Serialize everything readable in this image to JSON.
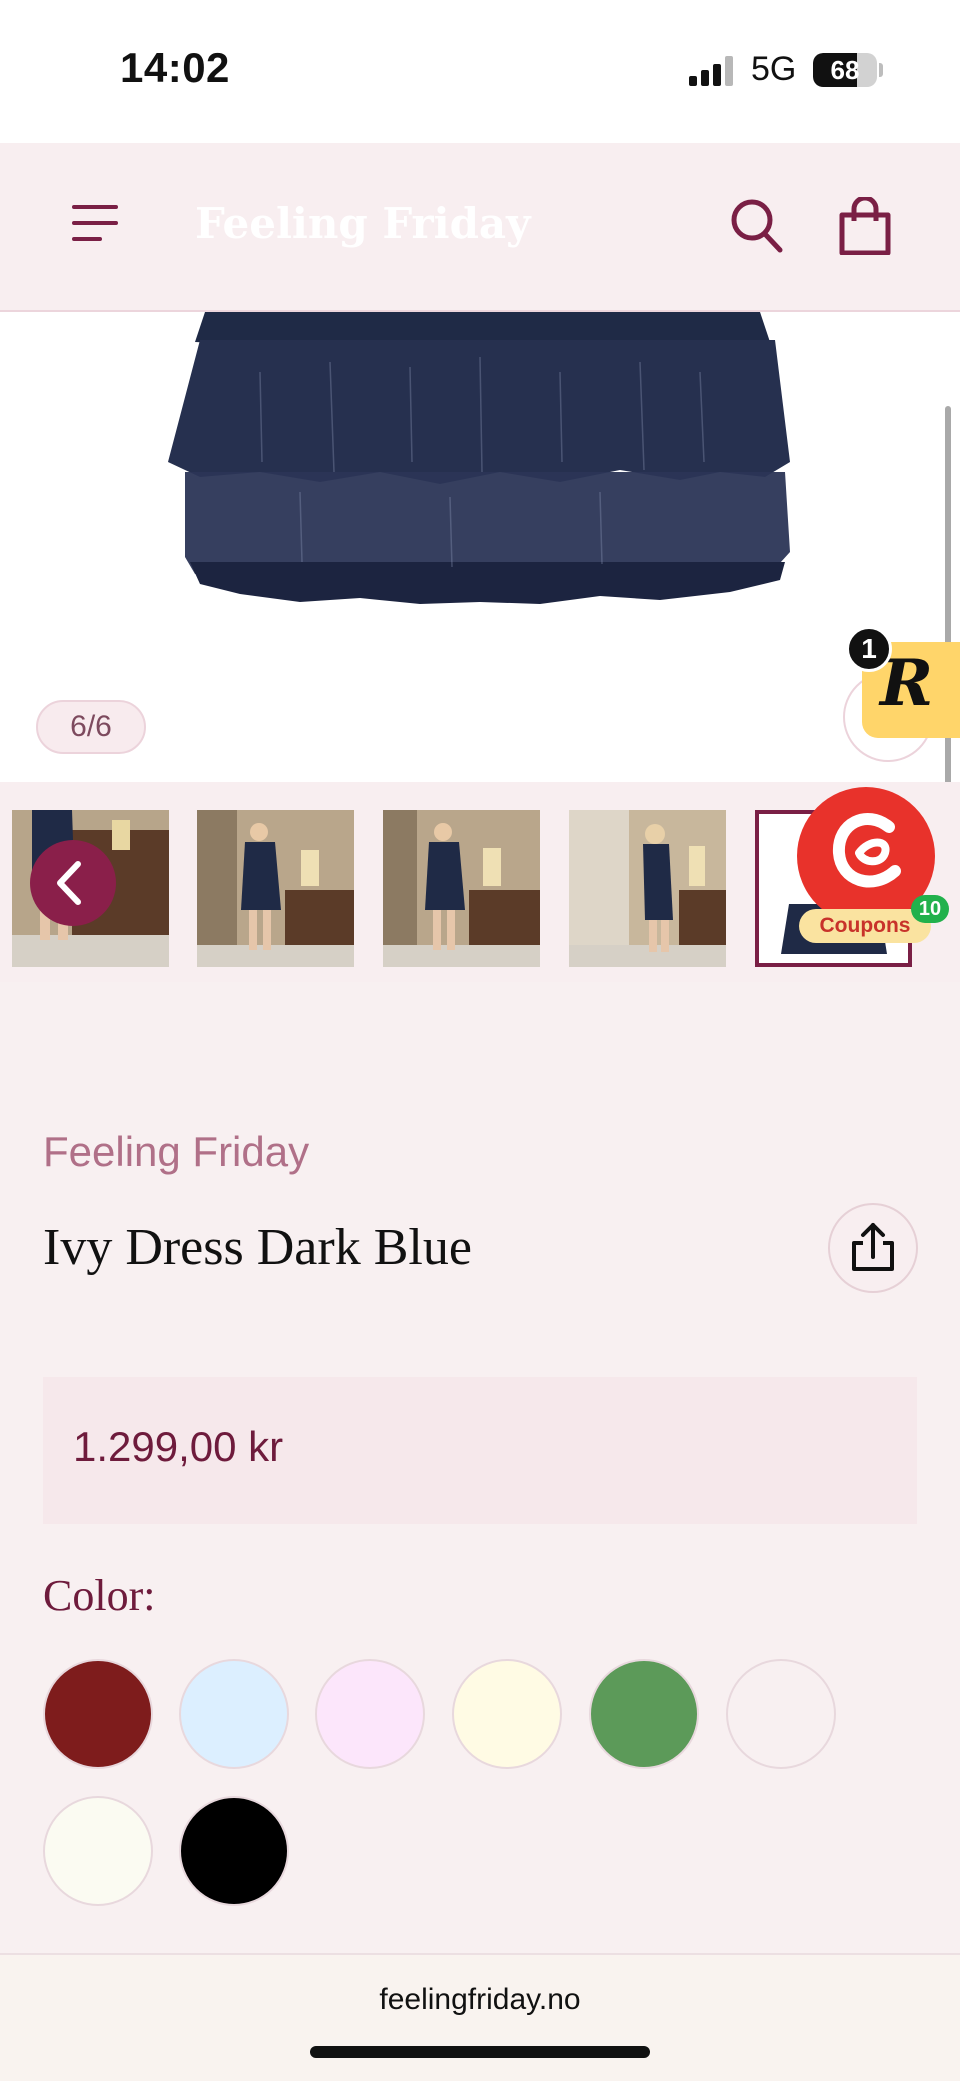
{
  "status_bar": {
    "time": "14:02",
    "network": "5G",
    "battery": "68",
    "battery_level": 0.68
  },
  "header": {
    "logo": "Feeling Friday",
    "icons": [
      "menu-icon",
      "search-icon",
      "shopping-bag-icon"
    ]
  },
  "gallery": {
    "counter": "6/6",
    "thumbnail_count": 5,
    "active_thumbnail": 5
  },
  "widgets": {
    "rewards_badge": "1",
    "rewards_logo": "R",
    "coupons_label": "Coupons",
    "coupons_count": "10"
  },
  "product": {
    "brand": "Feeling Friday",
    "title": "Ivy Dress Dark Blue",
    "price": "1.299,00 kr"
  },
  "options": {
    "color_label": "Color:",
    "swatches": [
      "#7e1c1c",
      "#dcefff",
      "#fce6fb",
      "#fffbe4",
      "#5c9a59",
      "#f8f0f1",
      "#fbfbf2",
      "#000000"
    ]
  },
  "browser": {
    "url": "feelingfriday.no"
  }
}
